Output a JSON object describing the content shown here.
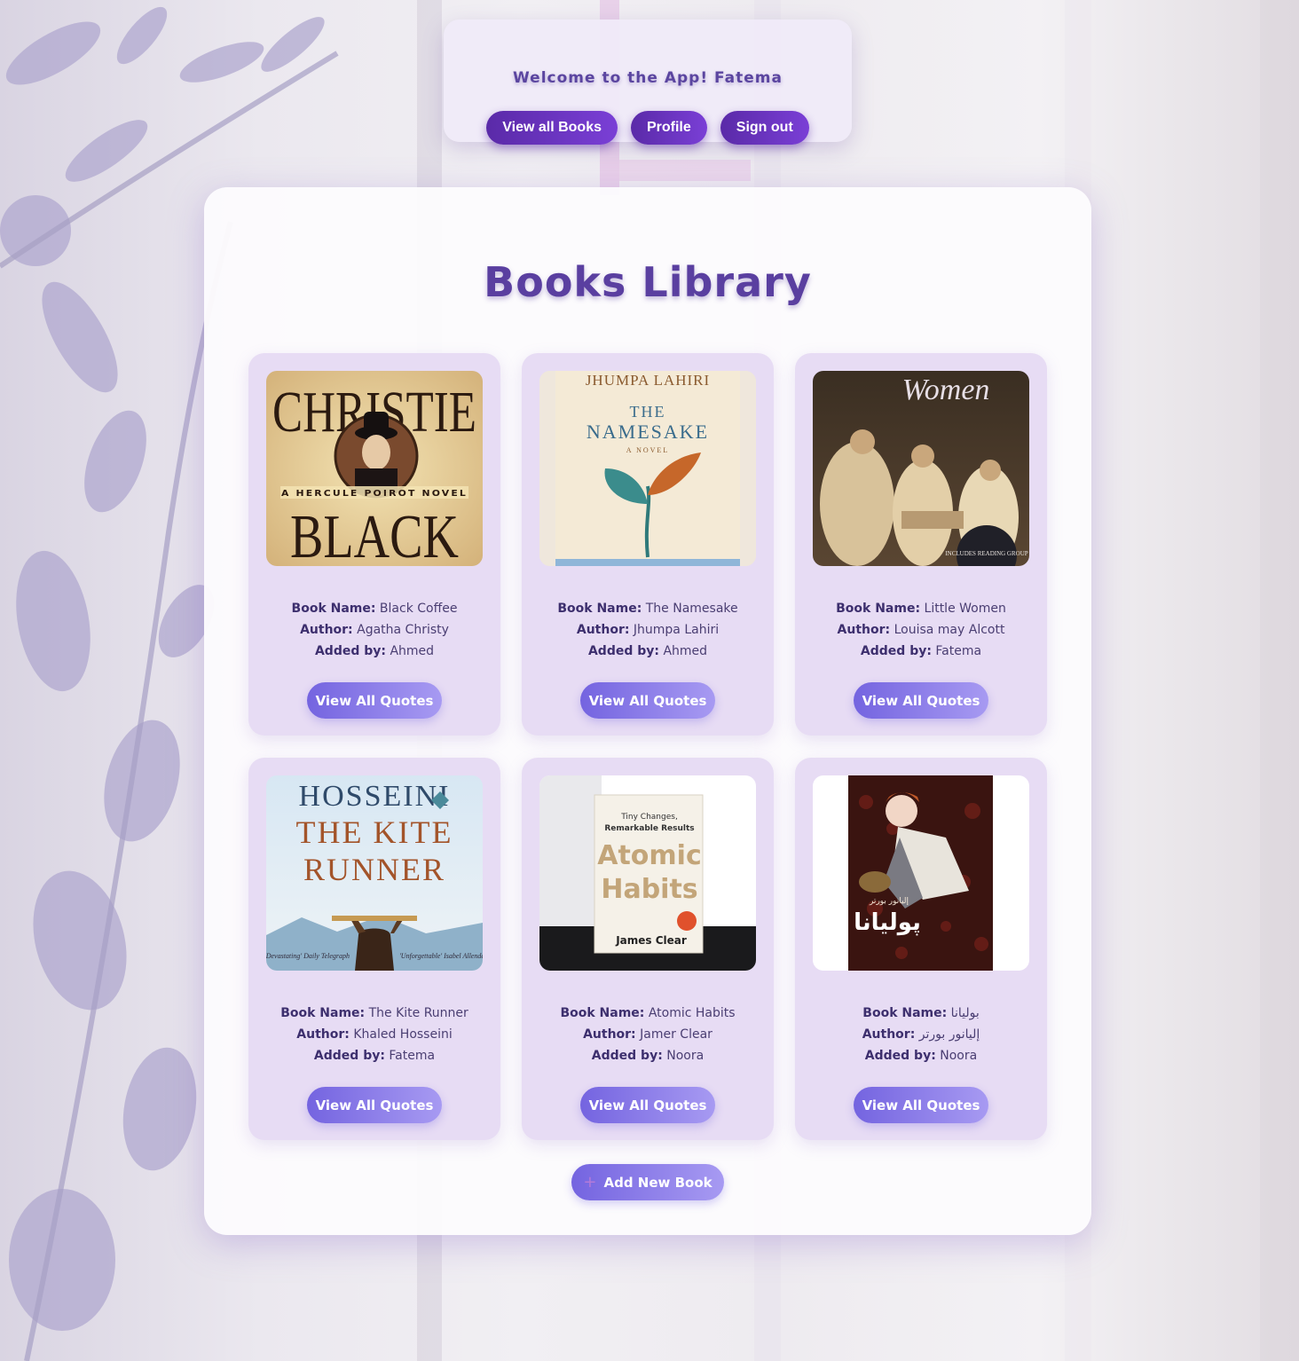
{
  "header": {
    "welcome": "Welcome to the App! Fatema",
    "nav": [
      "View all Books",
      "Profile",
      "Sign out"
    ]
  },
  "main": {
    "title": "Books Library",
    "labels": {
      "name": "Book Name:",
      "author": "Author:",
      "added": "Added by:"
    },
    "quotes_label": "View All Quotes",
    "add_label": "Add New Book",
    "add_icon": "plus-icon"
  },
  "books": [
    {
      "name": "Black Coffee",
      "author": "Agatha Christy",
      "added_by": "Ahmed",
      "cover": {
        "lines": [
          "CHRISTIE",
          "A HERCULE POIROT NOVEL",
          "BLACK"
        ]
      }
    },
    {
      "name": "The Namesake",
      "author": "Jhumpa Lahiri",
      "added_by": "Ahmed",
      "cover": {
        "lines": [
          "JHUMPA LAHIRI",
          "THE",
          "NAMESAKE",
          "A NOVEL"
        ]
      }
    },
    {
      "name": "Little Women",
      "author": "Louisa may Alcott",
      "added_by": "Fatema",
      "cover": {
        "lines": [
          "Women",
          "INCLUDES READING GROUP"
        ]
      }
    },
    {
      "name": "The Kite Runner",
      "author": "Khaled Hosseini",
      "added_by": "Fatema",
      "cover": {
        "lines": [
          "HOSSEINI",
          "THE KITE",
          "RUNNER",
          "'Devastating' Daily Telegraph",
          "'Unforgettable' Isabel Allende"
        ]
      }
    },
    {
      "name": "Atomic Habits",
      "author": "Jamer Clear",
      "added_by": "Noora",
      "cover": {
        "lines": [
          "Tiny Changes,",
          "Remarkable Results",
          "Atomic",
          "Habits",
          "James Clear"
        ]
      }
    },
    {
      "name": "بوليانا",
      "author": "إليانور بورتر",
      "added_by": "Noora",
      "cover": {
        "lines": [
          "إليانور بورتر",
          "پوليانا"
        ]
      }
    }
  ],
  "colors": {
    "accent": "#5a2aa8",
    "title": "#5a3fa0",
    "card": "#e7dcf4",
    "button": "#7464e0"
  }
}
